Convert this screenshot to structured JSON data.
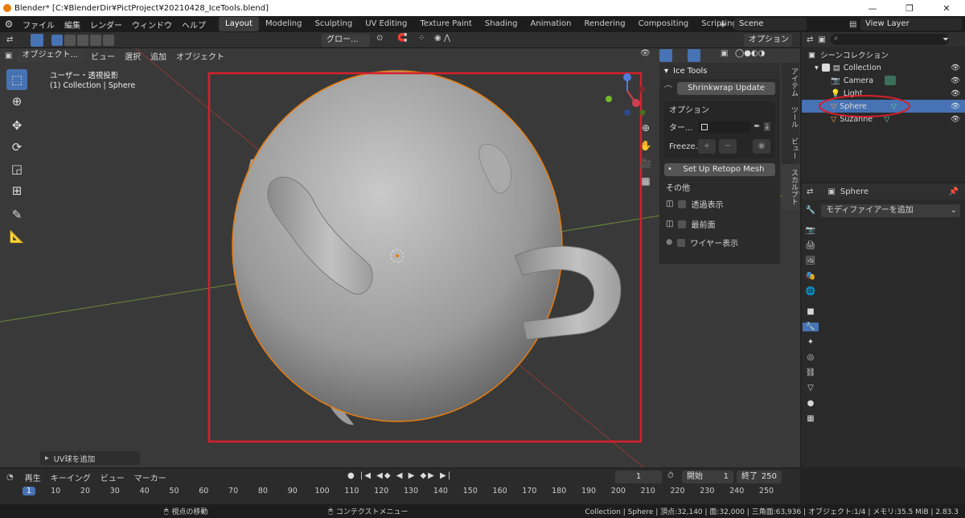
{
  "window": {
    "title": "Blender* [C:¥BlenderDir¥PictProject¥20210428_IceTools.blend]",
    "minimize": "—",
    "maximize": "❐",
    "close": "✕"
  },
  "menu": [
    "ファイル",
    "編集",
    "レンダー",
    "ウィンドウ",
    "ヘルプ"
  ],
  "workspaces": [
    {
      "label": "Layout",
      "active": true
    },
    {
      "label": "Modeling"
    },
    {
      "label": "Sculpting"
    },
    {
      "label": "UV Editing"
    },
    {
      "label": "Texture Paint"
    },
    {
      "label": "Shading"
    },
    {
      "label": "Animation"
    },
    {
      "label": "Rendering"
    },
    {
      "label": "Compositing"
    },
    {
      "label": "Scripting"
    }
  ],
  "scene": "Scene",
  "view_layer": "View Layer",
  "toolheader": {
    "orientation": "グロー...",
    "options": "オプション"
  },
  "viewport_header": {
    "mode": "オブジェクト...",
    "items": [
      "ビュー",
      "選択",
      "追加",
      "オブジェクト"
    ]
  },
  "viewport": {
    "overlay_line1": "ユーザー・透視投影",
    "overlay_line2": "(1) Collection | Sphere",
    "last_op": "UV球を追加"
  },
  "npanel": {
    "tabs": [
      "アイテム",
      "ツール",
      "ビュー",
      "スカルプト"
    ],
    "header": "Ice Tools",
    "shrinkwrap_btn": "Shrinkwrap Update",
    "options_label": "オプション",
    "target_label": "ター...",
    "freeze_label": "Freeze...",
    "retopo_btn": "Set Up Retopo Mesh",
    "misc_label": "その他",
    "checks": [
      "透過表示",
      "最前面",
      "ワイヤー表示"
    ]
  },
  "outliner": {
    "root": "シーンコレクション",
    "collection": "Collection",
    "objects": [
      "Camera",
      "Light",
      "Sphere",
      "Suzanne"
    ],
    "selected": "Sphere"
  },
  "properties": {
    "object_name": "Sphere",
    "add_modifier": "モディファイアーを追加"
  },
  "timeline": {
    "menu": [
      "再生",
      "キーイング",
      "ビュー",
      "マーカー"
    ],
    "current_frame": "1",
    "start_label": "開始",
    "start": "1",
    "end_label": "終了",
    "end": "250",
    "ticks": [
      "1",
      "10",
      "20",
      "30",
      "40",
      "50",
      "60",
      "70",
      "80",
      "90",
      "100",
      "110",
      "120",
      "130",
      "140",
      "150",
      "160",
      "170",
      "180",
      "190",
      "200",
      "210",
      "220",
      "230",
      "240",
      "250"
    ]
  },
  "status": {
    "left": "視点の移動",
    "middle": "コンテクストメニュー",
    "right": "Collection | Sphere | 頂点:32,140 | 面:32,000 | 三角面:63,936 | オブジェクト:1/4 | メモリ:35.5 MiB | 2.83.3"
  },
  "colors": {
    "accent": "#4772b3",
    "selection": "#e87d0d",
    "highlight_box": "#d6202a"
  }
}
